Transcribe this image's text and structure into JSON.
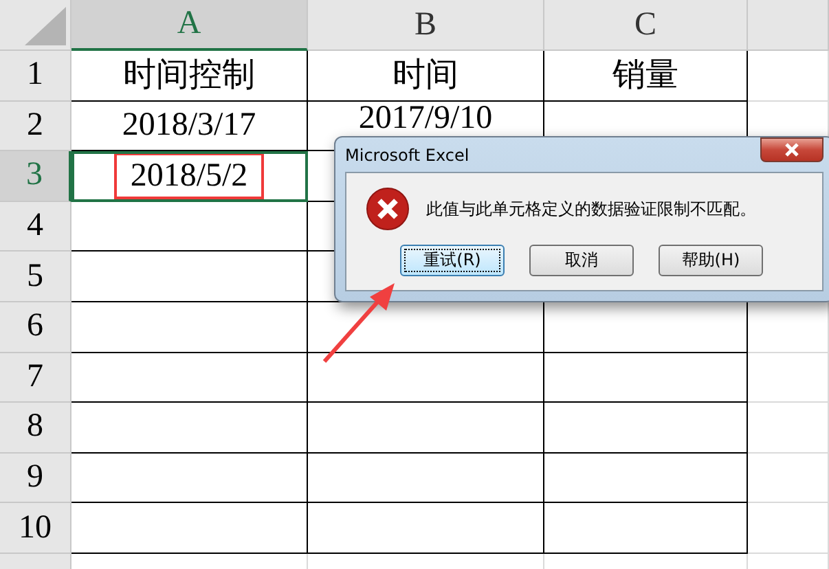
{
  "columns": [
    {
      "label": "A",
      "selected": true
    },
    {
      "label": "B",
      "selected": false
    },
    {
      "label": "C",
      "selected": false
    }
  ],
  "rows": [
    {
      "label": "1",
      "selected": false,
      "cells": [
        {
          "text": "时间控制",
          "boxed": false
        },
        {
          "text": "时间",
          "boxed": false
        },
        {
          "text": "销量",
          "boxed": false
        }
      ]
    },
    {
      "label": "2",
      "selected": false,
      "cells": [
        {
          "text": "2018/3/17",
          "boxed": false
        },
        {
          "text": "2017/9/10",
          "boxed": false
        }
      ]
    },
    {
      "label": "3",
      "selected": true,
      "cells": [
        {
          "text": "2018/5/2",
          "boxed": true
        }
      ]
    },
    {
      "label": "4",
      "selected": false
    },
    {
      "label": "5",
      "selected": false
    },
    {
      "label": "6",
      "selected": false
    },
    {
      "label": "7",
      "selected": false
    },
    {
      "label": "8",
      "selected": false
    },
    {
      "label": "9",
      "selected": false
    },
    {
      "label": "10",
      "selected": false
    }
  ],
  "dialog": {
    "title": "Microsoft Excel",
    "message": "此值与此单元格定义的数据验证限制不匹配。",
    "buttons": [
      {
        "label": "重试(R)",
        "selected": true
      },
      {
        "label": "取消",
        "selected": false
      },
      {
        "label": "帮助(H)",
        "selected": false
      }
    ]
  }
}
